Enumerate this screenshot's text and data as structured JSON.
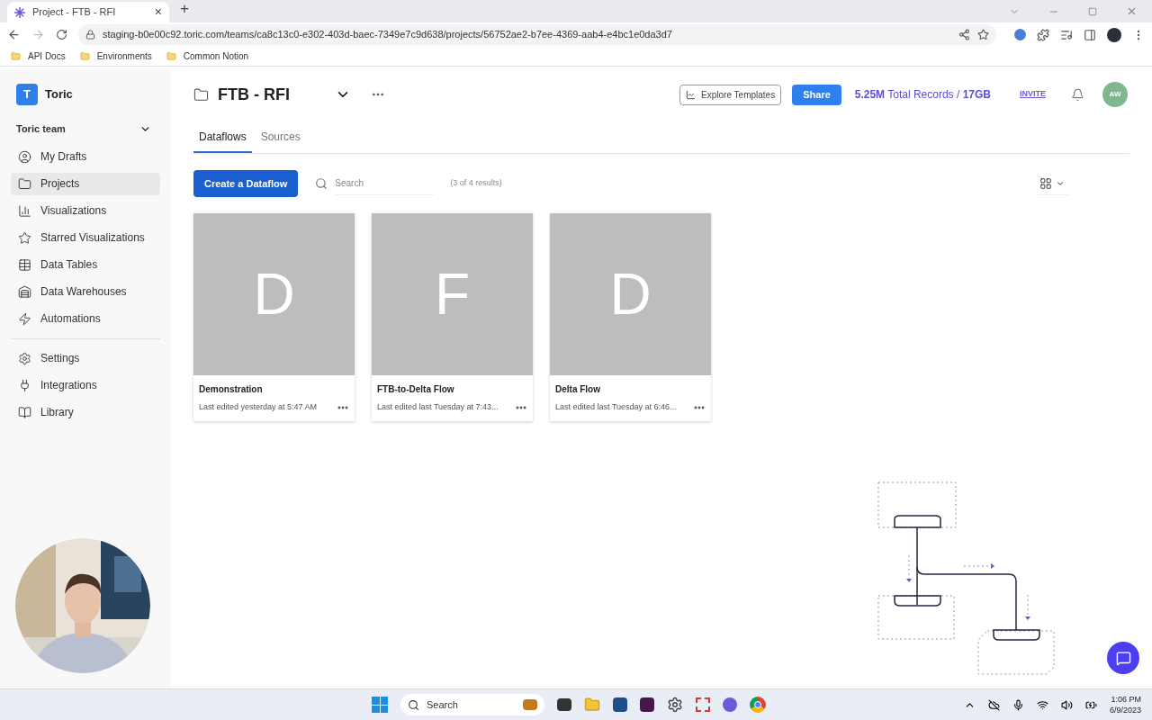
{
  "browser": {
    "tab": {
      "title": "Project - FTB - RFI",
      "close": "×"
    },
    "new_tab": "+",
    "url": "staging-b0e00c92.toric.com/teams/ca8c13c0-e302-403d-baec-7349e7c9d638/projects/56752ae2-b7ee-4369-aab4-e4bc1e0da3d7",
    "bookmarks": [
      "API Docs",
      "Environments",
      "Common Notion"
    ]
  },
  "sidebar": {
    "logo_letter": "T",
    "brand": "Toric",
    "team": "Toric team",
    "items": [
      {
        "label": "My Drafts",
        "selected": false
      },
      {
        "label": "Projects",
        "selected": true
      },
      {
        "label": "Visualizations",
        "selected": false
      },
      {
        "label": "Starred Visualizations",
        "selected": false
      },
      {
        "label": "Data Tables",
        "selected": false
      },
      {
        "label": "Data Warehouses",
        "selected": false
      },
      {
        "label": "Automations",
        "selected": false
      }
    ],
    "bottom_items": [
      {
        "label": "Settings",
        "selected": false
      },
      {
        "label": "Integrations",
        "selected": false
      },
      {
        "label": "Library",
        "selected": false
      }
    ]
  },
  "header": {
    "project": "FTB - RFI",
    "explore": "Explore Templates",
    "share": "Share",
    "records_count": "5.25M",
    "records_label": "Total Records /",
    "size": "17GB",
    "invite": "INVITE",
    "avatar": "AW"
  },
  "tabs": [
    {
      "label": "Dataflows",
      "selected": true
    },
    {
      "label": "Sources",
      "selected": false
    }
  ],
  "toolbar": {
    "create": "Create a Dataflow",
    "search_placeholder": "Search",
    "results": "(3 of 4 results)"
  },
  "cards": [
    {
      "letter": "D",
      "title": "Demonstration",
      "edited": "Last edited yesterday at 5:47 AM"
    },
    {
      "letter": "F",
      "title": "FTB-to-Delta Flow",
      "edited": "Last edited last Tuesday at 7:43..."
    },
    {
      "letter": "D",
      "title": "Delta Flow",
      "edited": "Last edited last Tuesday at 6:46..."
    }
  ],
  "taskbar": {
    "search": "Search",
    "time": "1:06 PM",
    "date": "6/9/2023"
  }
}
